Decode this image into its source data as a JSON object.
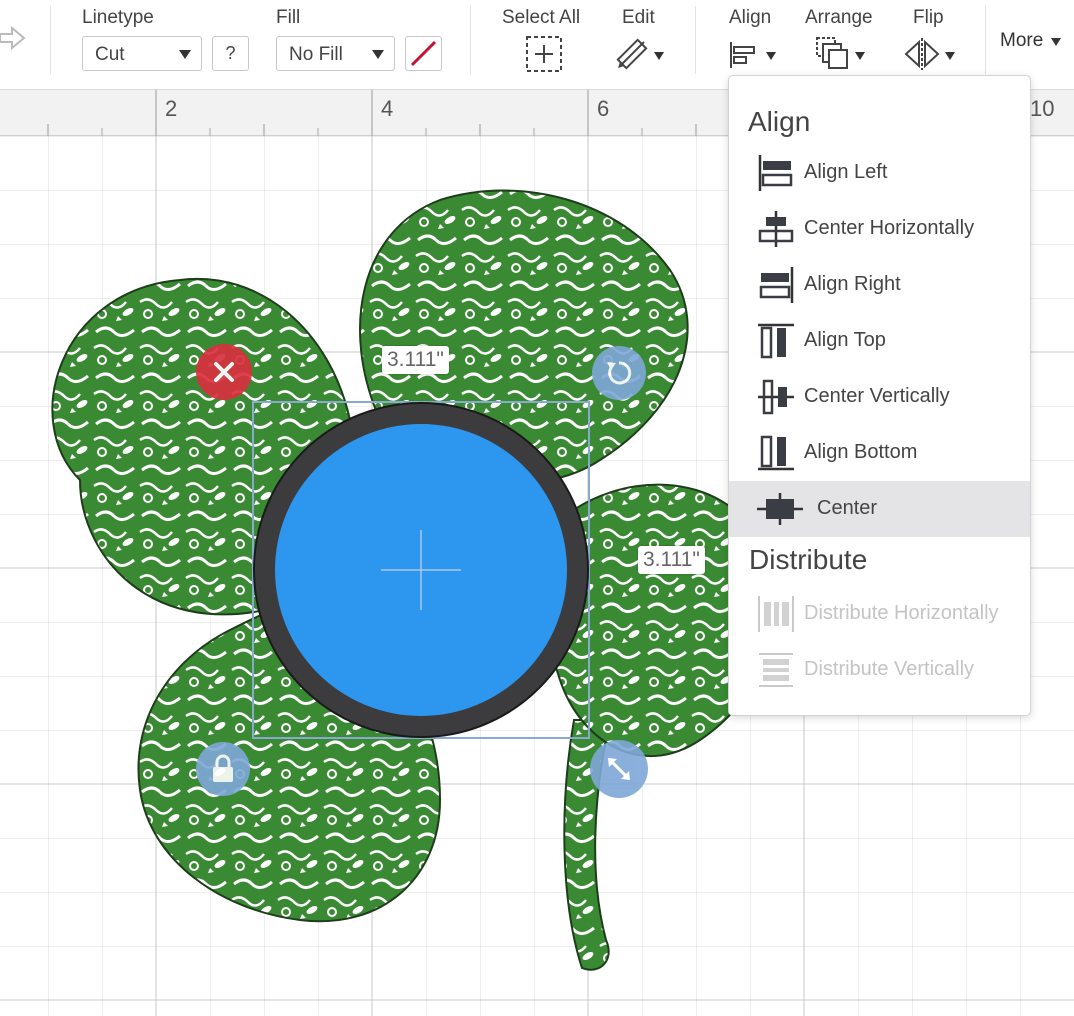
{
  "toolbar": {
    "linetype": {
      "label": "Linetype",
      "value": "Cut"
    },
    "help_label": "?",
    "fill": {
      "label": "Fill",
      "value": "No Fill"
    },
    "select_all_label": "Select All",
    "edit_label": "Edit",
    "align_label": "Align",
    "arrange_label": "Arrange",
    "flip_label": "Flip",
    "more_label": "More"
  },
  "ruler": {
    "ticks": [
      "2",
      "4",
      "6",
      "10"
    ]
  },
  "canvas": {
    "width_label": "3.111\"",
    "height_label": "3.111\"",
    "shape_fill": "#2d96ee",
    "shape_ring": "#3c3c3e",
    "clover_color": "#3a8a34",
    "delete_color": "#d9303f",
    "handle_color": "#7fa7d8"
  },
  "align_menu": {
    "align_heading": "Align",
    "items": [
      {
        "label": "Align Left",
        "icon": "align-left-icon",
        "state": "normal"
      },
      {
        "label": "Center Horizontally",
        "icon": "center-horizontally-icon",
        "state": "normal"
      },
      {
        "label": "Align Right",
        "icon": "align-right-icon",
        "state": "normal"
      },
      {
        "label": "Align Top",
        "icon": "align-top-icon",
        "state": "normal"
      },
      {
        "label": "Center Vertically",
        "icon": "center-vertically-icon",
        "state": "normal"
      },
      {
        "label": "Align Bottom",
        "icon": "align-bottom-icon",
        "state": "normal"
      },
      {
        "label": "Center",
        "icon": "center-icon",
        "state": "active"
      }
    ],
    "distribute_heading": "Distribute",
    "distribute_items": [
      {
        "label": "Distribute Horizontally",
        "icon": "distribute-horizontally-icon",
        "state": "disabled"
      },
      {
        "label": "Distribute Vertically",
        "icon": "distribute-vertically-icon",
        "state": "disabled"
      }
    ]
  }
}
